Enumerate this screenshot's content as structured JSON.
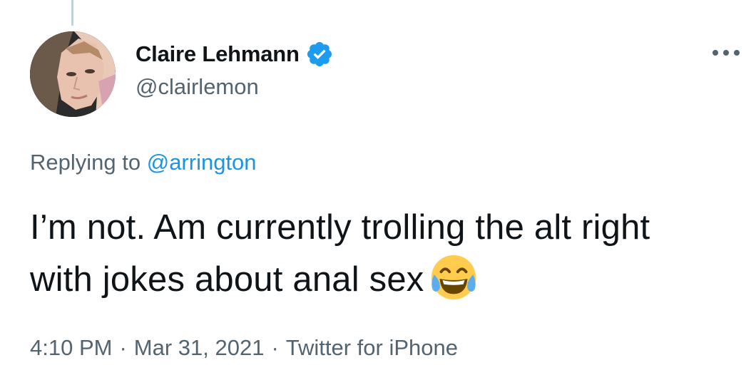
{
  "tweet": {
    "author": {
      "display_name": "Claire Lehmann",
      "handle": "@clairlemon",
      "verified": true
    },
    "reply": {
      "prefix": "Replying to",
      "mention": "@arrington"
    },
    "text": "I’m not. Am currently trolling the alt right with jokes about anal sex",
    "emoji": "face-with-tears-of-joy",
    "meta": {
      "time": "4:10 PM",
      "separator": "·",
      "date": "Mar 31, 2021",
      "source": "Twitter for iPhone"
    }
  },
  "colors": {
    "text_primary": "#0f1419",
    "text_secondary": "#536471",
    "link": "#1b95e0",
    "verified_badge": "#1d9bf0",
    "thread_line": "#c4cfd6"
  },
  "icons": {
    "verified": "verified-badge-icon",
    "more": "more-options-icon",
    "emoji": "tears-of-joy-emoji-icon"
  }
}
